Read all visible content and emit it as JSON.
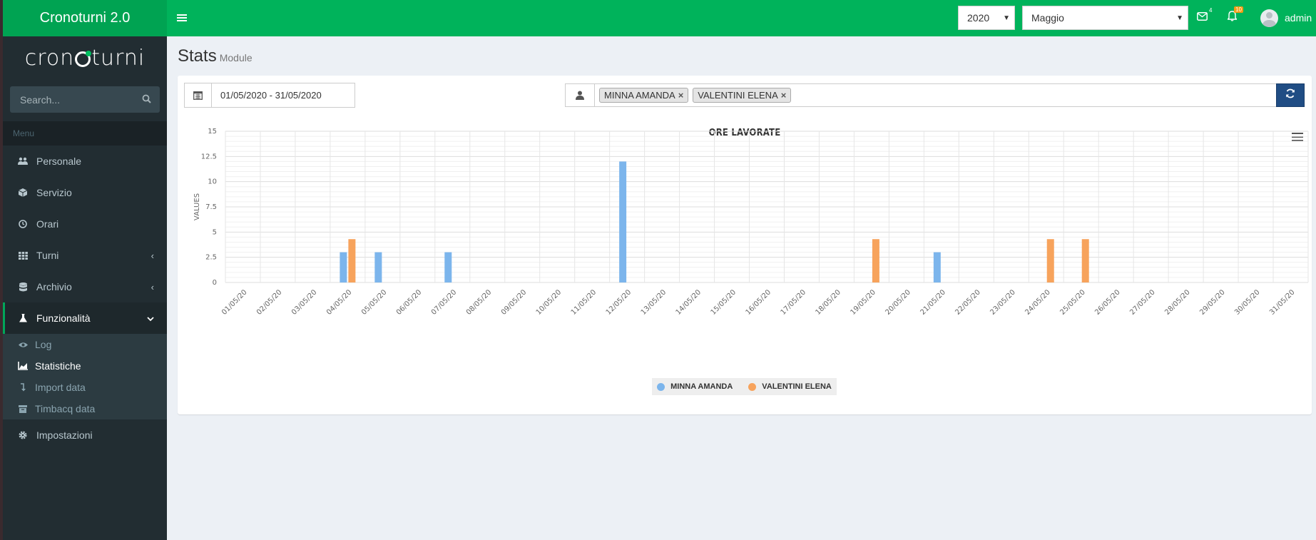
{
  "app": {
    "title": "Cronoturni 2.0",
    "brand_left": "cron",
    "brand_right": "turni"
  },
  "sidebar": {
    "search_placeholder": "Search...",
    "menu_header": "Menu",
    "items": [
      {
        "label": "Personale",
        "icon": "users-icon"
      },
      {
        "label": "Servizio",
        "icon": "cube-icon"
      },
      {
        "label": "Orari",
        "icon": "clock-icon"
      },
      {
        "label": "Turni",
        "icon": "grid-icon"
      },
      {
        "label": "Archivio",
        "icon": "database-icon"
      },
      {
        "label": "Funzionalità",
        "icon": "flask-icon"
      }
    ],
    "subitems": [
      {
        "label": "Log",
        "icon": "eye-icon"
      },
      {
        "label": "Statistiche",
        "icon": "area-chart-icon"
      },
      {
        "label": "Import data",
        "icon": "level-down-icon"
      },
      {
        "label": "Timbacq data",
        "icon": "archive-icon"
      }
    ],
    "settings": {
      "label": "Impostazioni",
      "icon": "gear-icon"
    }
  },
  "topbar": {
    "year": "2020",
    "month": "Maggio",
    "mail_count": "4",
    "notif_count": "10",
    "user": "admin"
  },
  "page": {
    "title": "Stats",
    "subtitle": "Module"
  },
  "filters": {
    "date_range": "01/05/2020 - 31/05/2020",
    "people": [
      "MINNA AMANDA",
      "VALENTINI ELENA"
    ]
  },
  "colors": {
    "green": "#00b35b",
    "series1": "#7cb5ec",
    "series2": "#f7a35c",
    "refresh": "#204d84"
  },
  "chart_data": {
    "type": "bar",
    "title": "ORE LAVORATE",
    "ylabel": "VALUES",
    "ylim": [
      0,
      15
    ],
    "yticks": [
      "0",
      "2.5",
      "5",
      "7.5",
      "10",
      "12.5",
      "15"
    ],
    "categories": [
      "01/05/20",
      "02/05/20",
      "03/05/20",
      "04/05/20",
      "05/05/20",
      "06/05/20",
      "07/05/20",
      "08/05/20",
      "09/05/20",
      "10/05/20",
      "11/05/20",
      "12/05/20",
      "13/05/20",
      "14/05/20",
      "15/05/20",
      "16/05/20",
      "17/05/20",
      "18/05/20",
      "19/05/20",
      "20/05/20",
      "21/05/20",
      "22/05/20",
      "23/05/20",
      "24/05/20",
      "25/05/20",
      "26/05/20",
      "27/05/20",
      "28/05/20",
      "29/05/20",
      "30/05/20",
      "31/05/20"
    ],
    "series": [
      {
        "name": "MINNA AMANDA",
        "color": "#7cb5ec",
        "values": [
          0,
          0,
          0,
          3,
          3,
          0,
          3,
          0,
          0,
          0,
          0,
          12,
          0,
          0,
          0,
          0,
          0,
          0,
          0,
          0,
          3,
          0,
          0,
          0,
          0,
          0,
          0,
          0,
          0,
          0,
          0
        ]
      },
      {
        "name": "VALENTINI ELENA",
        "color": "#f7a35c",
        "values": [
          0,
          0,
          0,
          4.3,
          0,
          0,
          0,
          0,
          0,
          0,
          0,
          0,
          0,
          0,
          0,
          0,
          0,
          0,
          4.3,
          0,
          0,
          0,
          0,
          4.3,
          4.3,
          0,
          0,
          0,
          0,
          0,
          0
        ]
      }
    ],
    "grid": true,
    "legend": "bottom-center"
  }
}
